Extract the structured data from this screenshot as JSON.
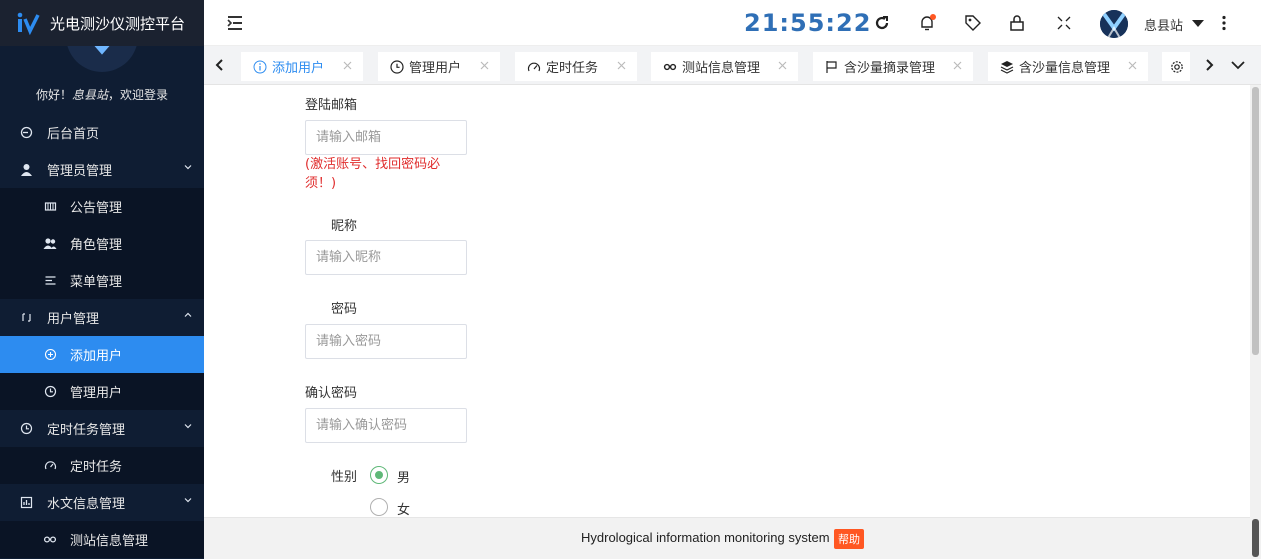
{
  "app": {
    "title": "光电测沙仪测控平台",
    "welcome_prefix": "你好！",
    "welcome_user": "息县站",
    "welcome_suffix": "，欢迎登录"
  },
  "header": {
    "clock": "21:55:22",
    "user_name": "息县站",
    "notification_dot_color": "#ff5722"
  },
  "sidebar": {
    "items": [
      {
        "label": "后台首页",
        "icon": "home-icon"
      },
      {
        "label": "管理员管理",
        "icon": "user-icon"
      },
      {
        "label": "公告管理",
        "icon": "notice-icon"
      },
      {
        "label": "角色管理",
        "icon": "users-icon"
      },
      {
        "label": "菜单管理",
        "icon": "menu-icon"
      },
      {
        "label": "用户管理",
        "icon": "bracket-icon"
      },
      {
        "label": "添加用户",
        "icon": "add-circle-icon"
      },
      {
        "label": "管理用户",
        "icon": "clock-icon"
      },
      {
        "label": "定时任务管理",
        "icon": "clock-icon"
      },
      {
        "label": "定时任务",
        "icon": "gauge-icon"
      },
      {
        "label": "水文信息管理",
        "icon": "chart-icon"
      },
      {
        "label": "测站信息管理",
        "icon": "link-icon"
      }
    ]
  },
  "tabs": [
    {
      "label": "添加用户",
      "icon": "info-icon"
    },
    {
      "label": "管理用户",
      "icon": "clock-icon"
    },
    {
      "label": "定时任务",
      "icon": "gauge-icon"
    },
    {
      "label": "测站信息管理",
      "icon": "link-icon"
    },
    {
      "label": "含沙量摘录管理",
      "icon": "flag-icon"
    },
    {
      "label": "含沙量信息管理",
      "icon": "layers-icon"
    }
  ],
  "form": {
    "email_label": "登陆邮箱",
    "email_placeholder": "请输入邮箱",
    "email_hint": "(激活账号、找回密码必须！)",
    "nickname_label": "昵称",
    "nickname_placeholder": "请输入昵称",
    "password_label": "密码",
    "password_placeholder": "请输入密码",
    "confirm_label": "确认密码",
    "confirm_placeholder": "请输入确认密码",
    "gender_label": "性别",
    "gender_options": [
      "男",
      "女"
    ],
    "gender_selected": "男"
  },
  "footer": {
    "text": "Hydrological information monitoring system",
    "help_label": "帮助"
  },
  "colors": {
    "sidebar_bg": "#0f1d33",
    "active_blue": "#2d8cf0",
    "clock_blue": "#2f6fb6",
    "warning_red": "#e02d2d",
    "radio_green": "#5fb878",
    "help_orange": "#ff5722"
  }
}
